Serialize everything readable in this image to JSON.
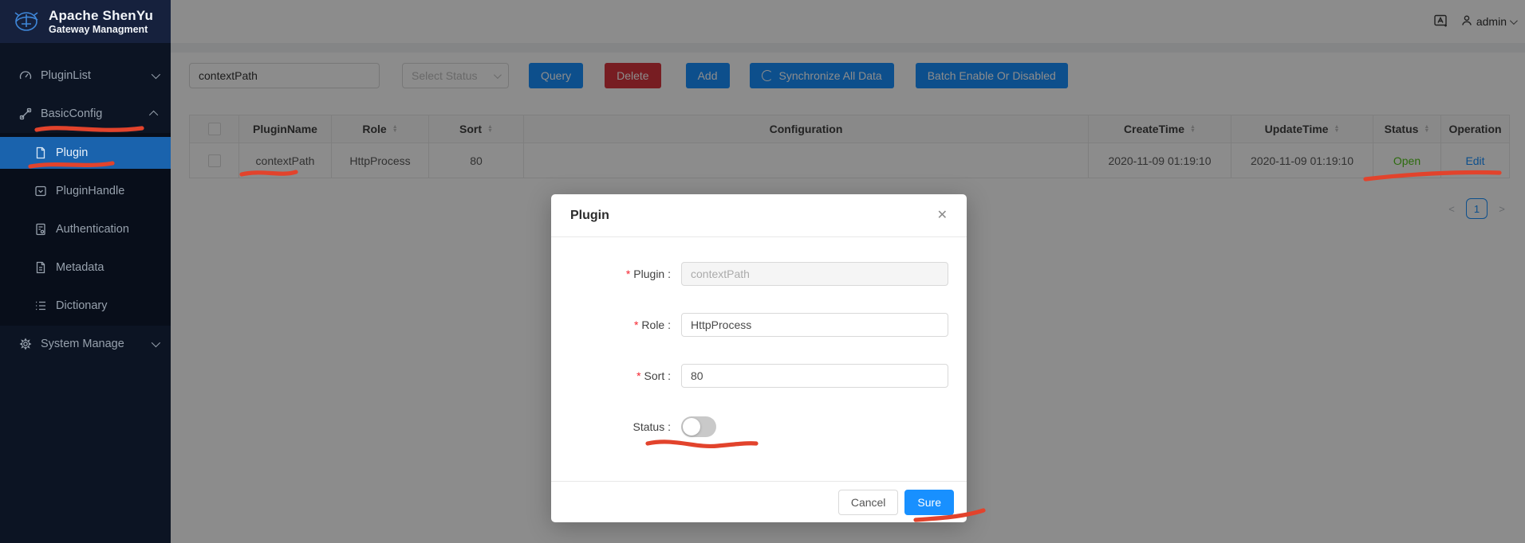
{
  "colors": {
    "accent": "#1890ff",
    "danger": "#d9363e",
    "success": "#52c41a",
    "sidebar_selected": "#1a63ad",
    "annotation": "#e2432c"
  },
  "sidebar": {
    "logo_title": "Apache ShenYu",
    "logo_subtitle": "Gateway Managment",
    "items": {
      "plugin_list": "PluginList",
      "basic_config": "BasicConfig",
      "system_manage": "System Manage"
    },
    "submenu": [
      "Plugin",
      "PluginHandle",
      "Authentication",
      "Metadata",
      "Dictionary"
    ]
  },
  "topbar": {
    "username": "admin"
  },
  "toolbar": {
    "search_value": "contextPath",
    "status_placeholder": "Select Status",
    "query": "Query",
    "delete": "Delete",
    "add": "Add",
    "sync": "Synchronize All Data",
    "batch": "Batch Enable Or Disabled"
  },
  "table": {
    "columns": [
      "PluginName",
      "Role",
      "Sort",
      "Configuration",
      "CreateTime",
      "UpdateTime",
      "Status",
      "Operation"
    ],
    "row": {
      "plugin_name": "contextPath",
      "role": "HttpProcess",
      "sort": "80",
      "configuration": "",
      "create_time": "2020-11-09 01:19:10",
      "update_time": "2020-11-09 01:19:10",
      "status": "Open",
      "operation": "Edit"
    }
  },
  "pagination": {
    "page": "1"
  },
  "modal": {
    "title": "Plugin",
    "close_glyph": "✕",
    "required_mark": "*",
    "fields": {
      "plugin_label": "Plugin :",
      "plugin_value": "contextPath",
      "role_label": "Role :",
      "role_value": "HttpProcess",
      "sort_label": "Sort :",
      "sort_value": "80",
      "status_label": "Status :"
    },
    "cancel": "Cancel",
    "sure": "Sure"
  }
}
